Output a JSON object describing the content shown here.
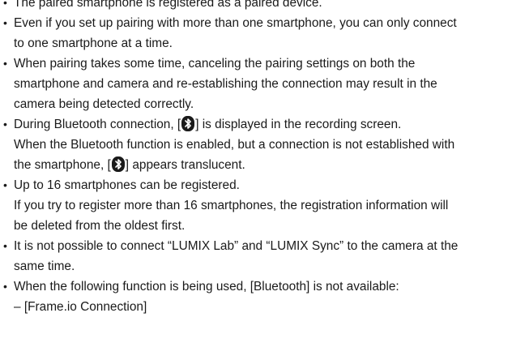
{
  "bullet_glyph": "•",
  "lines": {
    "l1": "The paired smartphone is registered as a paired device.",
    "l2": "Even if you set up pairing with more than one smartphone, you can only connect",
    "l3": "to one smartphone at a time.",
    "l4": "When pairing takes some time, canceling the pairing settings on both the",
    "l5": "smartphone and camera and re-establishing the connection may result in the",
    "l6": "camera being detected correctly.",
    "l7a": "During Bluetooth connection, [",
    "l7b": "] is displayed in the recording screen.",
    "l8": "When the Bluetooth function is enabled, but a connection is not established with",
    "l9a": "the smartphone, [",
    "l9b": "] appears translucent.",
    "l10": "Up to 16 smartphones can be registered.",
    "l11": "If you try to register more than 16 smartphones, the registration information will",
    "l12": "be deleted from the oldest first.",
    "l13": "It is not possible to connect “LUMIX Lab” and “LUMIX Sync” to the camera at the",
    "l14": "same time.",
    "l15": "When the following function is being used, [Bluetooth] is not available:",
    "l16": "– [Frame.io Connection]"
  },
  "icons": {
    "bluetooth": "bluetooth-icon"
  },
  "colors": {
    "text": "#1a1a1a",
    "icon_bg": "#1a1a1a",
    "icon_fg": "#ffffff"
  }
}
